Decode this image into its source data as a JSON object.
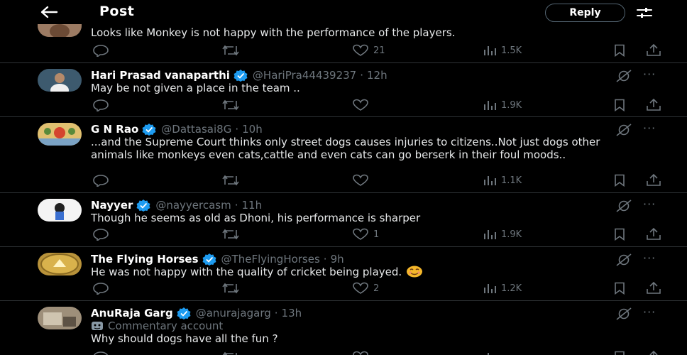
{
  "header": {
    "title": "Post",
    "reply_label": "Reply"
  },
  "tweets": [
    {
      "body": "Looks like Monkey is not happy with the performance of the players.",
      "likes": "21",
      "views": "1.5K"
    },
    {
      "name": "Hari Prasad vanaparthi",
      "handle": "@HariPra44439237",
      "time": "12h",
      "body": "May be not given a place in the team ..",
      "views": "1.9K"
    },
    {
      "name": "G N Rao",
      "handle": "@Dattasai8G",
      "time": "10h",
      "body": "...and the Supreme Court thinks only street dogs causes injuries to citizens..Not just dogs other animals like monkeys even cats,cattle and even cats can go berserk in their foul moods..",
      "views": "1.1K"
    },
    {
      "name": "Nayyer",
      "handle": "@nayyercasm",
      "time": "11h",
      "body": "Though he seems as old as Dhoni, his performance is sharper",
      "likes": "1",
      "views": "1.9K"
    },
    {
      "name": "The Flying Horses",
      "handle": "@TheFlyingHorses",
      "time": "9h",
      "body": "He was not happy with the quality of cricket being played.",
      "likes": "2",
      "views": "1.2K"
    },
    {
      "name": "AnuRaja Garg",
      "handle": "@anurajagarg",
      "time": "13h",
      "label": "Commentary account",
      "body": "Why should dogs have all the fun ?"
    }
  ],
  "colors": {
    "background": "#000000",
    "verified": "#1d9bf0",
    "muted": "#6e767d",
    "text": "#e7e9ea"
  },
  "icons": [
    "back-arrow-icon",
    "filter-icon",
    "reply-icon",
    "retweet-icon",
    "like-icon",
    "views-icon",
    "bookmark-icon",
    "share-icon",
    "grok-icon",
    "more-icon",
    "verified-badge-icon"
  ]
}
